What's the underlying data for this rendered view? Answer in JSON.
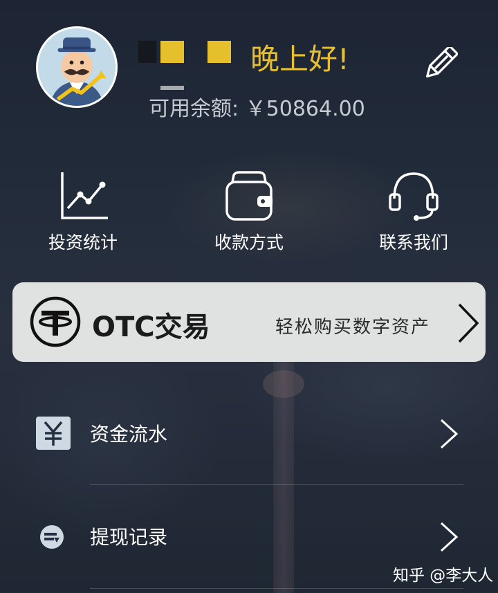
{
  "header": {
    "greeting": "晚上好!",
    "balance_label": "可用余额:",
    "balance_value": "￥50864.00",
    "accent_color": "#e7bf2f"
  },
  "icons": {
    "avatar": "cartoon-investor-avatar",
    "edit": "pencil-icon"
  },
  "quick_actions": [
    {
      "label": "投资统计",
      "icon": "line-chart-icon"
    },
    {
      "label": "收款方式",
      "icon": "wallet-icon"
    },
    {
      "label": "联系我们",
      "icon": "headset-icon"
    }
  ],
  "otc_banner": {
    "title": "OTC交易",
    "subtitle": "轻松购买数字资产",
    "icon": "tether-logo-icon"
  },
  "menu": [
    {
      "label": "资金流水",
      "icon": "yen-icon"
    },
    {
      "label": "提现记录",
      "icon": "withdraw-icon"
    }
  ],
  "watermark": "知乎 @李大人"
}
